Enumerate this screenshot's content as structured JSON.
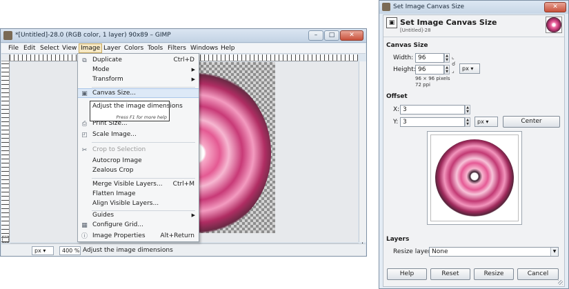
{
  "gimp": {
    "window_title": "*[Untitled]-28.0 (RGB color, 1 layer) 90x89 – GIMP",
    "caption_buttons": [
      "–",
      "□",
      "✕"
    ],
    "menubar": [
      "File",
      "Edit",
      "Select",
      "View",
      "Image",
      "Layer",
      "Colors",
      "Tools",
      "Filters",
      "Windows",
      "Help"
    ],
    "active_menu": "Image",
    "status": {
      "unit": "px",
      "zoom": "400 %",
      "message": "Adjust the image dimensions"
    },
    "nav_icon": "✛"
  },
  "image_menu": {
    "items": [
      {
        "label": "Duplicate",
        "accel": "Ctrl+D",
        "icon": "duplicate-icon",
        "glyph": "⧉"
      },
      {
        "label": "Mode",
        "submenu": true
      },
      {
        "label": "Transform",
        "submenu": true
      },
      {
        "label": "Canvas Size...",
        "icon": "canvas-size-icon",
        "glyph": "▣",
        "highlighted": true
      },
      {
        "label": "Print Size...",
        "icon": "print-size-icon",
        "glyph": "⎙"
      },
      {
        "label": "Scale Image...",
        "icon": "scale-image-icon",
        "glyph": "◰"
      },
      {
        "label": "Crop to Selection",
        "icon": "crop-icon",
        "glyph": "✂",
        "disabled": true
      },
      {
        "label": "Autocrop Image"
      },
      {
        "label": "Zealous Crop"
      },
      {
        "label": "Merge Visible Layers...",
        "accel": "Ctrl+M"
      },
      {
        "label": "Flatten Image"
      },
      {
        "label": "Align Visible Layers..."
      },
      {
        "label": "Guides",
        "submenu": true
      },
      {
        "label": "Configure Grid...",
        "icon": "grid-icon",
        "glyph": "▦"
      },
      {
        "label": "Image Properties",
        "accel": "Alt+Return",
        "icon": "info-icon",
        "glyph": "ⓘ"
      }
    ],
    "tooltip": {
      "text": "Adjust the image dimensions",
      "hint": "Press F1 for more help"
    }
  },
  "dialog": {
    "window_title": "Set Image Canvas Size",
    "header_title": "Set Image Canvas Size",
    "header_subtitle": "[Untitled]-28",
    "canvas_size_label": "Canvas Size",
    "width_label": "Width:",
    "width_value": "96",
    "height_label": "Height:",
    "height_value": "96",
    "size_unit": "px",
    "info_pixels": "96 × 96 pixels",
    "info_ppi": "72 ppi",
    "offset_label": "Offset",
    "x_label": "X:",
    "x_value": "3",
    "y_label": "Y:",
    "y_value": "3",
    "offset_unit": "px",
    "center_button": "Center",
    "layers_label": "Layers",
    "resize_layers_label": "Resize layers:",
    "resize_layers_value": "None",
    "buttons": {
      "help": "Help",
      "reset": "Reset",
      "resize": "Resize",
      "cancel": "Cancel"
    }
  }
}
